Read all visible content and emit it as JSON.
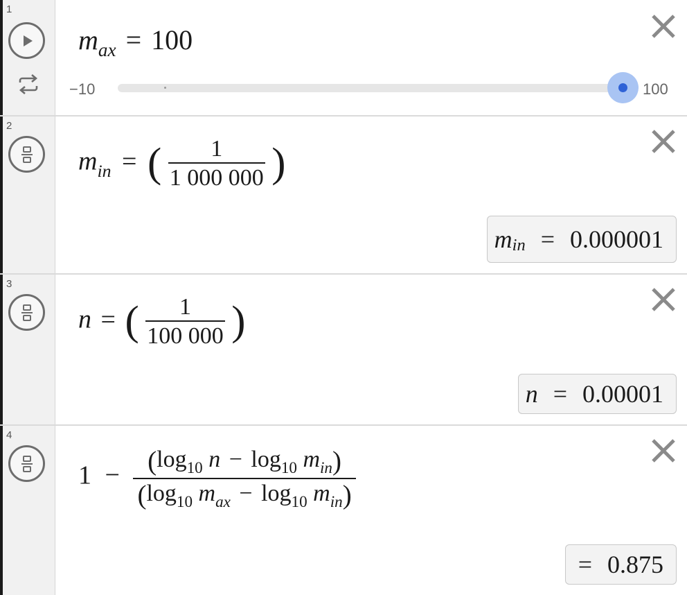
{
  "rows": [
    {
      "number": "1",
      "lhs_base": "m",
      "lhs_sub": "ax",
      "equals": "=",
      "value": "100",
      "slider": {
        "min_label": "−10",
        "max_label": "100",
        "value_fraction": 1.0
      },
      "play_icon": "play-icon",
      "repeat_icon": "repeat-icon"
    },
    {
      "number": "2",
      "lhs_base": "m",
      "lhs_sub": "in",
      "equals": "=",
      "frac_num": "1",
      "frac_den": "1 000 000",
      "result": {
        "base": "m",
        "sub": "in",
        "equals": "=",
        "value": "0.000001"
      }
    },
    {
      "number": "3",
      "lhs_base": "n",
      "equals": "=",
      "frac_num": "1",
      "frac_den": "100 000",
      "result": {
        "base": "n",
        "equals": "=",
        "value": "0.00001"
      }
    },
    {
      "number": "4",
      "one": "1",
      "minus": "−",
      "log": "log",
      "ten": "10",
      "n": "n",
      "m": "m",
      "in_sub": "in",
      "ax_sub": "ax",
      "result": {
        "equals": "=",
        "value": "0.875"
      }
    }
  ],
  "colors": {
    "slider_thumb": "#2f62d6",
    "slider_halo": "#a9c4f3",
    "gutter": "#f1f1f1"
  }
}
